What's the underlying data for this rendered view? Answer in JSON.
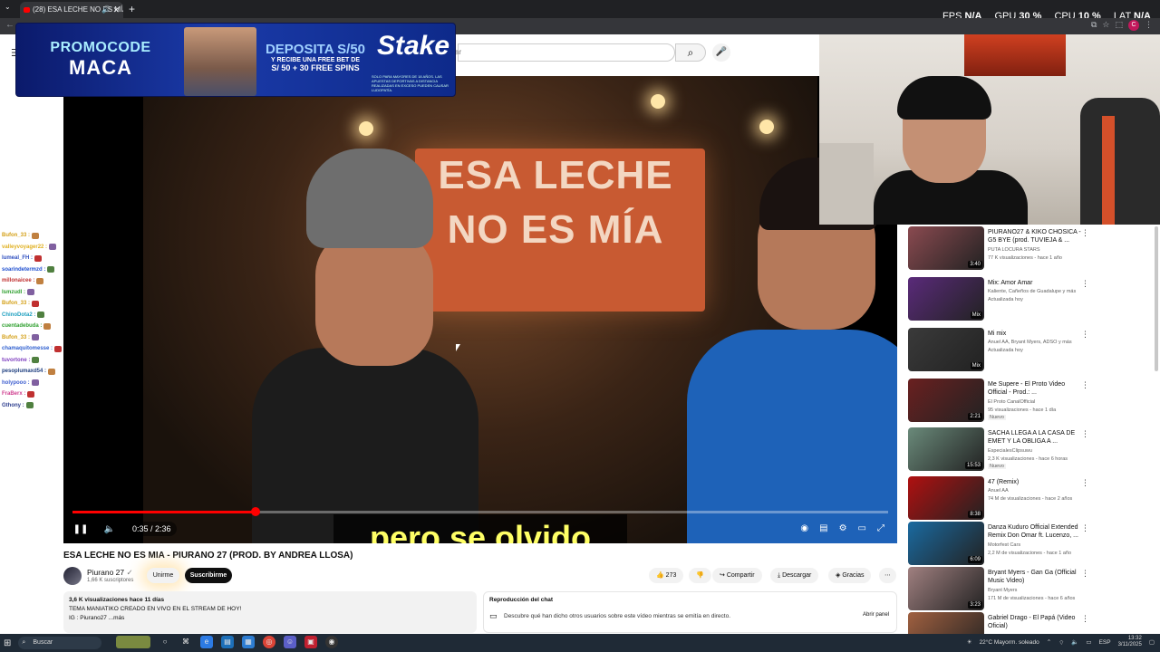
{
  "browser": {
    "tab_title": "(28) ESA LECHE NO ES MÍA",
    "new_tab": "+",
    "tab_close": "✕",
    "stats": [
      {
        "label": "FPS",
        "value": "N/A"
      },
      {
        "label": "GPU",
        "value": "30 %"
      },
      {
        "label": "CPU",
        "value": "10 %"
      },
      {
        "label": "LAT",
        "value": "N/A"
      }
    ],
    "profile_initial": "C"
  },
  "youtube": {
    "search_placeholder": "ar"
  },
  "promo": {
    "line1": "PROMOCODE",
    "line2": "MACA",
    "deposit": "DEPOSITA S/50",
    "receive": "Y RECIBE UNA FREE BET DE",
    "bonus": "S/ 50 + 30 FREE SPINS",
    "brand": "Stake",
    "legal": "SOLO PARA MAYORES DE 18 AÑOS. LAS APUESTAS DEPORTIVAS A DISTANCIA REALIZADAS EN EXCESO PUEDEN CAUSAR LUDOPATÍA."
  },
  "video": {
    "sign_text": "ESA LECHE NO ES MÍA",
    "caption": "pero se olvido",
    "time": "0:35 / 2:36",
    "progress": 0.224
  },
  "chat": [
    {
      "user": "Bufon_33 :",
      "color": "#d4a017"
    },
    {
      "user": "valleyvoyager22 :",
      "color": "#e0b020"
    },
    {
      "user": "lumeal_FH :",
      "color": "#3050c0"
    },
    {
      "user": "soarindetermzd :",
      "color": "#2050d0"
    },
    {
      "user": "millonaicee :",
      "color": "#c03030"
    },
    {
      "user": "Ismzudl :",
      "color": "#30a030"
    },
    {
      "user": "Bufon_33 :",
      "color": "#d4a017"
    },
    {
      "user": "ChinoDota2 :",
      "color": "#20a0c0"
    },
    {
      "user": "cuentadebuda :",
      "color": "#30a030"
    },
    {
      "user": "Bufon_33 :",
      "color": "#d4a017"
    },
    {
      "user": "chamaquitomesse :",
      "color": "#3060d0"
    },
    {
      "user": "tuvortone :",
      "color": "#8040c0"
    },
    {
      "user": "pesoplumaxd54 :",
      "color": "#204080"
    },
    {
      "user": "holypooo :",
      "color": "#4060d0"
    },
    {
      "user": "FraBerx :",
      "color": "#d04090"
    },
    {
      "user": "Gthony :",
      "color": "#304090"
    }
  ],
  "meta": {
    "title": "ESA LECHE NO ES MIA - PIURANO 27 (PROD. BY ANDREA LLOSA)",
    "channel": "Piurano 27",
    "subs": "1,66 K suscriptores",
    "join": "Unirme",
    "subscribe": "Suscribirme",
    "likes": "273",
    "share": "Compartir",
    "download": "Descargar",
    "thanks": "Gracias",
    "views": "3,6 K visualizaciones  hace 11 días",
    "desc1": "TEMA MANIATIKO CREADO EN VIVO EN EL STREAM DE HOY!",
    "desc2": "IG : Piurano27 ...más",
    "chat_replay": "Reproducción del chat",
    "chat_replay_sub": "Descubre qué han dicho otros usuarios sobre este vídeo mientras se emitía en directo.",
    "open_panel": "Abrir panel"
  },
  "recs": [
    {
      "title": "PIURANO27 & KIKO CHOSICA - G5 BYE (prod. TUVIEJA & ...",
      "channel": "PUTA LOCURA STARS",
      "meta": "77 K visualizaciones - hace 1 año",
      "duration": "3:40",
      "color": "#8a4a50"
    },
    {
      "title": "Mix: Amor Amar",
      "channel": "Kaliente, Cañeños de Guadalupe y más",
      "meta": "Actualizada hoy",
      "duration": "Mix",
      "color": "#5a2a7a"
    },
    {
      "title": "Mi mix",
      "channel": "Anuel AA, Bryant Myers, ADSO y más",
      "meta": "Actualizada hoy",
      "duration": "Mix",
      "color": "#3a3a3a"
    },
    {
      "title": "Me Supere - El Proto Video Official - Prod.: ...",
      "channel": "El Proto CanalOfficial",
      "meta": "95 visualizaciones - hace 1 día",
      "badge": "Nuevo",
      "duration": "2:21",
      "color": "#6a2020"
    },
    {
      "title": "SACHA LLEGA A LA CASA DE EMET Y LA OBLIGA A ...",
      "channel": "EspecialesClipsuwu",
      "meta": "2,3 K visualizaciones - hace 6 horas",
      "badge": "Nuevo",
      "duration": "15:53",
      "color": "#6a8a7a"
    },
    {
      "title": "47 (Remix)",
      "channel": "Anuel AA",
      "meta": "74 M de visualizaciones - hace 2 años",
      "duration": "8:38",
      "color": "#b01010"
    },
    {
      "title": "Danza Kuduro Official Extended Remix Don Omar ft. Lucenzo, ...",
      "channel": "Motorfest Cars",
      "meta": "2,2 M de visualizaciones - hace 1 año",
      "duration": "6:09",
      "color": "#1a6aa0"
    },
    {
      "title": "Bryant Myers - Gan Ga (Official Music Video)",
      "channel": "Bryant Myers",
      "meta": "171 M de visualizaciones - hace 6 años",
      "duration": "3:23",
      "color": "#a08080"
    },
    {
      "title": "Gabriel Drago - El Papá (Video Oficial)",
      "channel": "",
      "meta": "",
      "duration": "",
      "color": "#a06040"
    }
  ],
  "taskbar": {
    "search": "Buscar",
    "weather": "22°C  Mayorm. soleado",
    "lang": "ESP",
    "time": "13:32",
    "date": "3/11/2025"
  }
}
